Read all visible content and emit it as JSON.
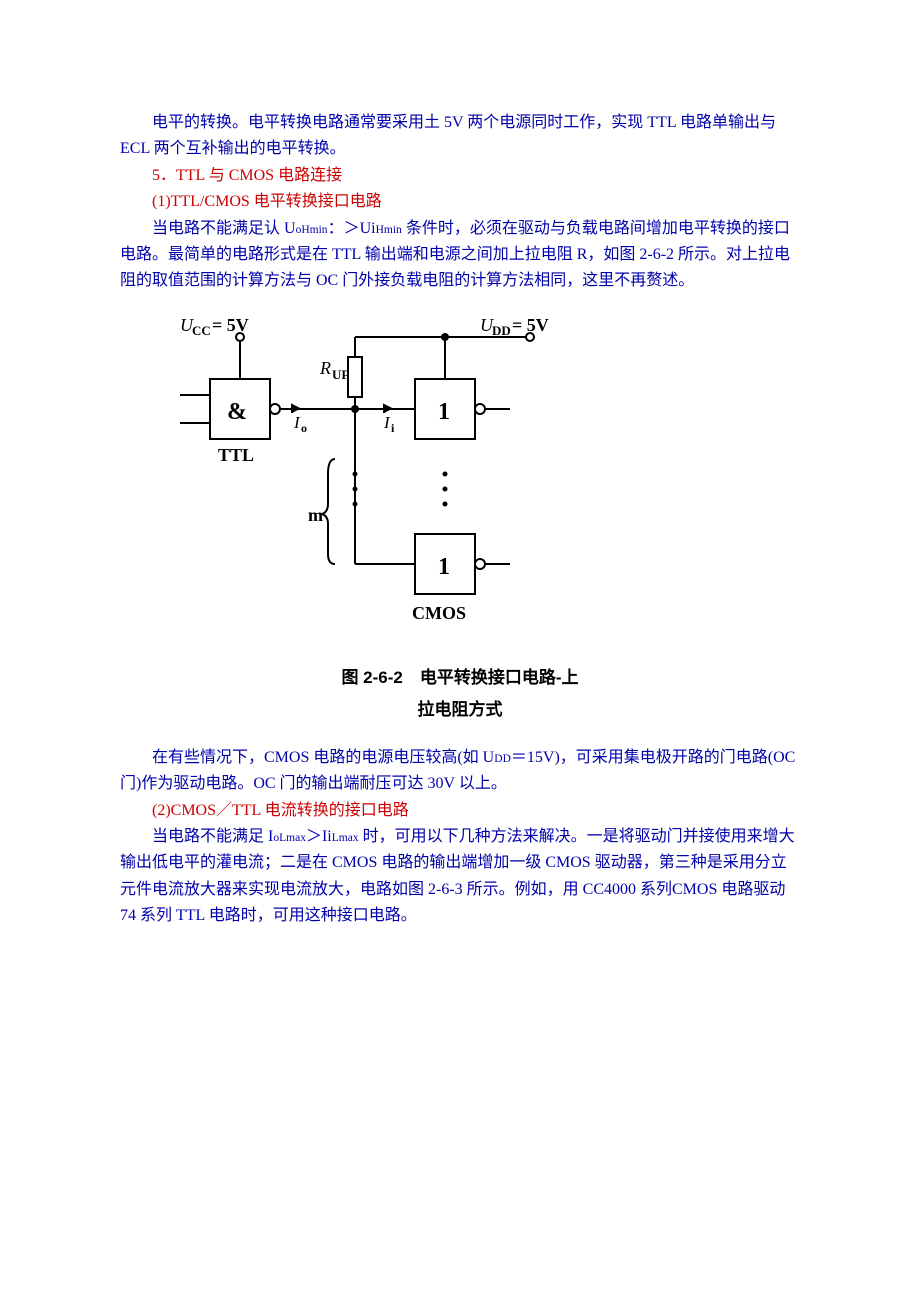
{
  "paragraphs": {
    "p1": "电平的转换。电平转换电路通常要采用土 5V 两个电源同时工作，实现 TTL 电路单输出与 ECL 两个互补输出的电平转换。",
    "h2": "5．TTL 与 CMOS 电路连接",
    "h3": "(1)TTL/CMOS 电平转换接口电路",
    "p2a": "当电路不能满足认 U",
    "p2a_sub": "oHmin",
    "p2b": "：＞Ui",
    "p2b_sub": "Hmin",
    "p2c": " 条件时，必须在驱动与负载电路间增加电平转换的接口电路。最简单的电路形式是在 TTL 输出端和电源之间加上拉电阻 R，如图 2-6-2 所示。对上拉电阻的取值范围的计算方法与 OC 门外接负载电阻的计算方法相同，这里不再赘述。",
    "p3a": "在有些情况下，CMOS 电路的电源电压较高(如 U",
    "p3a_sub": "DD",
    "p3b": "＝15V)，可采用集电极开路的门电路(OC 门)作为驱动电路。OC 门的输出端耐压可达 30V 以上。",
    "h4": "(2)CMOS／TTL 电流转换的接口电路",
    "p4a": "当电路不能满足 I",
    "p4a_sub": "oLmax",
    "p4b": "＞Ii",
    "p4b_sub": "Lmax",
    "p4c": " 时，可用以下几种方法来解决。一是将驱动门并接使用来增大输出低电平的灌电流；二是在 CMOS 电路的输出端增加一级 CMOS 驱动器，第三种是采用分立元件电流放大器来实现电流放大，电路如图 2-6-3 所示。例如，用 CC4000 系列CMOS 电路驱动 74 系列 TTL 电路时，可用这种接口电路。"
  },
  "figure": {
    "ucc": "U",
    "cc_sub": "CC",
    "ucc_val": "= 5V",
    "udd": "U",
    "dd_sub": "DD",
    "udd_val": "= 5V",
    "ruf": "R",
    "ruf_sub": "UF",
    "io": "I",
    "io_sub": "o",
    "ii": "I",
    "ii_sub": "i",
    "amp": "&",
    "one": "1",
    "ttl": "TTL",
    "cmos": "CMOS",
    "m": "m"
  },
  "caption": {
    "line1": "图 2-6-2　电平转换接口电路-上",
    "line2": "拉电阻方式"
  }
}
